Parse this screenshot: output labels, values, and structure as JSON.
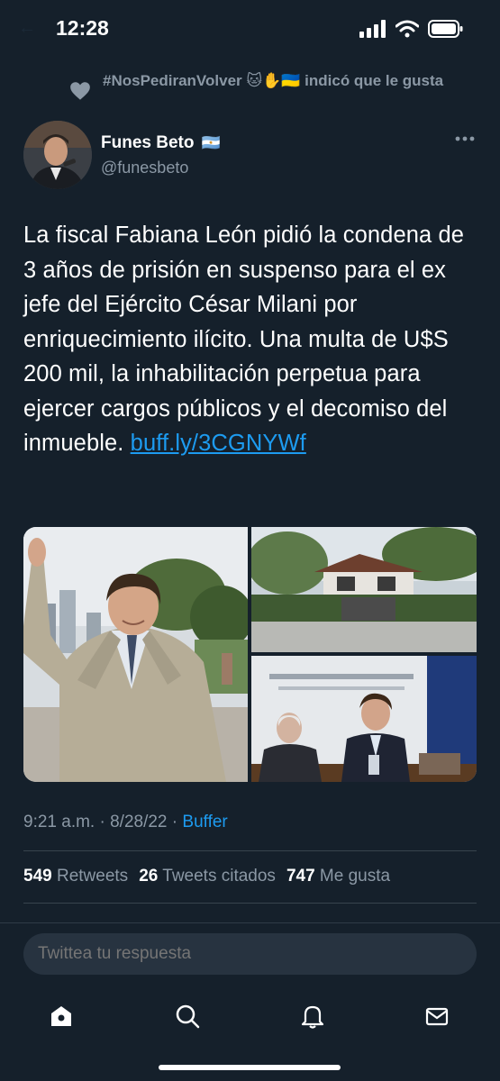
{
  "status": {
    "time": "12:28"
  },
  "social_context": {
    "liker": "#NosPediranVolver 🐱✋🇺🇦",
    "action": "indicó que le gusta"
  },
  "author": {
    "name": "Funes Beto",
    "flag": "🇦🇷",
    "handle": "@funesbeto"
  },
  "tweet": {
    "text": "La fiscal Fabiana León pidió la condena de 3 años de prisión en suspenso para el ex jefe del Ejército César Milani por enriquecimiento ilícito. Una multa de U$S 200 mil, la inhabilitación perpetua para ejercer cargos públicos y el decomiso del inmueble.",
    "link": "buff.ly/3CGNYWf"
  },
  "meta": {
    "time": "9:21 a.m.",
    "date": "8/28/22",
    "source": "Buffer"
  },
  "stats": {
    "retweets_count": "549",
    "retweets_label": "Retweets",
    "quotes_count": "26",
    "quotes_label": "Tweets citados",
    "likes_count": "747",
    "likes_label": "Me gusta"
  },
  "reply": {
    "placeholder": "Twittea tu respuesta"
  },
  "colors": {
    "background": "#15202b",
    "accent": "#1d9bf0",
    "secondary_text": "#8b98a5"
  },
  "icons": [
    "heart-icon",
    "more-icon",
    "home-icon",
    "search-icon",
    "bell-icon",
    "mail-icon"
  ]
}
